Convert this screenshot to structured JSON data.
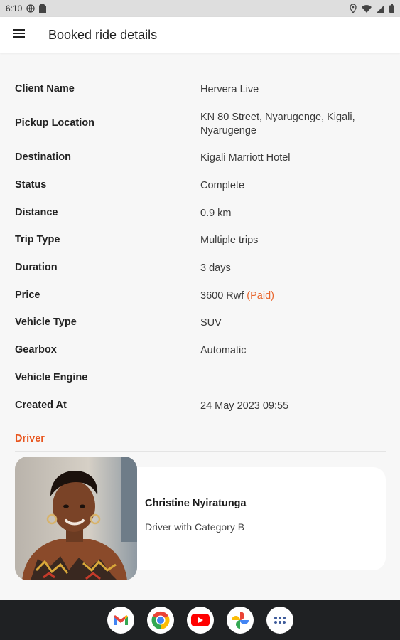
{
  "status_bar": {
    "time": "6:10"
  },
  "app_bar": {
    "title": "Booked ride details"
  },
  "details": [
    {
      "label": "Client Name",
      "value": "Hervera Live"
    },
    {
      "label": "Pickup Location",
      "value": "KN 80 Street, Nyarugenge, Kigali, Nyarugenge"
    },
    {
      "label": "Destination",
      "value": "Kigali Marriott Hotel"
    },
    {
      "label": "Status",
      "value": "Complete"
    },
    {
      "label": "Distance",
      "value": "0.9 km"
    },
    {
      "label": "Trip Type",
      "value": "Multiple trips"
    },
    {
      "label": "Duration",
      "value": "3 days"
    },
    {
      "label": "Price",
      "value": "3600 Rwf",
      "badge": "(Paid)"
    },
    {
      "label": "Vehicle Type",
      "value": "SUV"
    },
    {
      "label": "Gearbox",
      "value": "Automatic"
    },
    {
      "label": "Vehicle Engine",
      "value": ""
    },
    {
      "label": "Created At",
      "value": "24 May 2023 09:55"
    }
  ],
  "driver_section": {
    "heading": "Driver",
    "name": "Christine Nyiratunga",
    "category": "Driver with Category B"
  },
  "nav_bar": {
    "apps": [
      "gmail-icon",
      "chrome-icon",
      "youtube-icon",
      "photos-icon",
      "app-drawer-icon"
    ]
  },
  "colors": {
    "accent": "#e8561f",
    "paid": "#e8662d",
    "nav_bg": "#1f2123"
  }
}
